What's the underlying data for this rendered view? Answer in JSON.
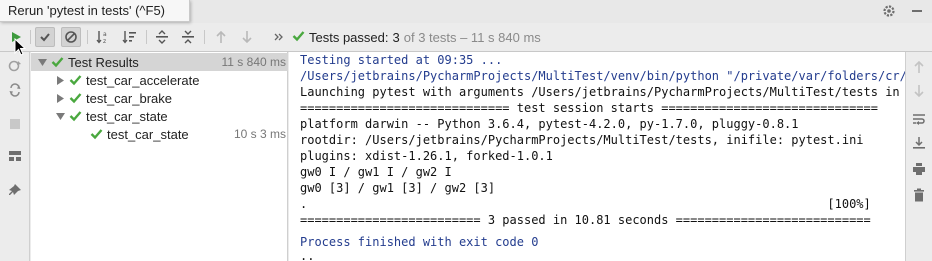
{
  "tooltip": {
    "text": "Rerun 'pytest in tests' (^F5)"
  },
  "status": {
    "label": "Tests passed:",
    "count": "3",
    "total": "of 3 tests – 11 s 840 ms"
  },
  "tree": {
    "root": {
      "label": "Test Results",
      "time": "11 s 840 ms"
    },
    "items": [
      {
        "label": "test_car_accelerate"
      },
      {
        "label": "test_car_brake"
      },
      {
        "label": "test_car_state"
      }
    ],
    "child": {
      "label": "test_car_state",
      "time": "10 s 3 ms"
    }
  },
  "console": {
    "lines": [
      "Testing started at 09:35 ...",
      "/Users/jetbrains/PycharmProjects/MultiTest/venv/bin/python \"/private/var/folders/cr/wzk",
      "Launching pytest with arguments /Users/jetbrains/PycharmProjects/MultiTest/tests in /Us",
      "============================= test session starts ==============================",
      "platform darwin -- Python 3.6.4, pytest-4.2.0, py-1.7.0, pluggy-0.8.1",
      "rootdir: /Users/jetbrains/PycharmProjects/MultiTest/tests, inifile: pytest.ini",
      "plugins: xdist-1.26.1, forked-1.0.1",
      "gw0 I / gw1 I / gw2 I",
      "gw0 [3] / gw1 [3] / gw2 [3]",
      ".                                                                        [100%]",
      "========================= 3 passed in 10.81 seconds ===========================",
      "",
      "Process finished with exit code 0",
      ".."
    ]
  },
  "colors": {
    "pass_green": "#4aa83f",
    "run_green": "#3d9a3d",
    "console_blue": "#233c8e"
  },
  "icons": {
    "top": [
      "gear-icon",
      "minimize-icon"
    ],
    "toolbar": [
      "rerun-icon",
      "show-passed-icon",
      "show-ignored-icon",
      "sort-alpha-icon",
      "sort-duration-icon",
      "expand-all-icon",
      "collapse-all-icon",
      "previous-failed-icon",
      "next-failed-icon",
      "more-icon"
    ],
    "left": [
      "rerun-failed-icon",
      "toggle-auto-test-icon",
      "stop-icon",
      "layout-icon",
      "pin-icon"
    ],
    "right": [
      "up-icon",
      "down-icon",
      "soft-wrap-icon",
      "scroll-to-end-icon",
      "print-icon",
      "trash-icon"
    ]
  }
}
